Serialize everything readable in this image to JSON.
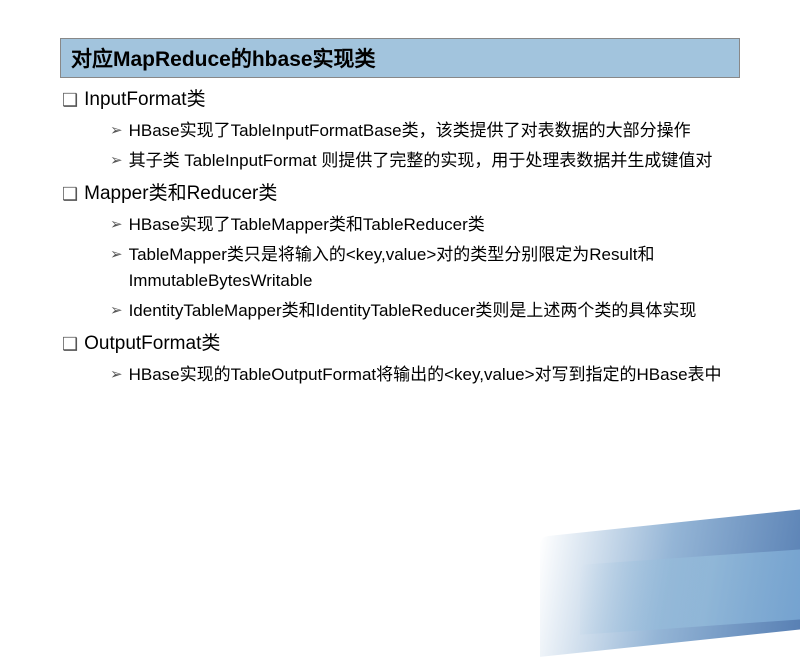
{
  "title": "对应MapReduce的hbase实现类",
  "sections": [
    {
      "heading": "InputFormat类",
      "items": [
        "HBase实现了TableInputFormatBase类，该类提供了对表数据的大部分操作",
        "其子类 TableInputFormat 则提供了完整的实现，用于处理表数据并生成键值对"
      ]
    },
    {
      "heading": "Mapper类和Reducer类",
      "items": [
        "HBase实现了TableMapper类和TableReducer类",
        "TableMapper类只是将输入的<key,value>对的类型分别限定为Result和ImmutableBytesWritable",
        "IdentityTableMapper类和IdentityTableReducer类则是上述两个类的具体实现"
      ]
    },
    {
      "heading": "OutputFormat类",
      "items": [
        "HBase实现的TableOutputFormat将输出的<key,value>对写到指定的HBase表中"
      ]
    }
  ],
  "bullets": {
    "level1": "❑",
    "level2": "➢"
  }
}
